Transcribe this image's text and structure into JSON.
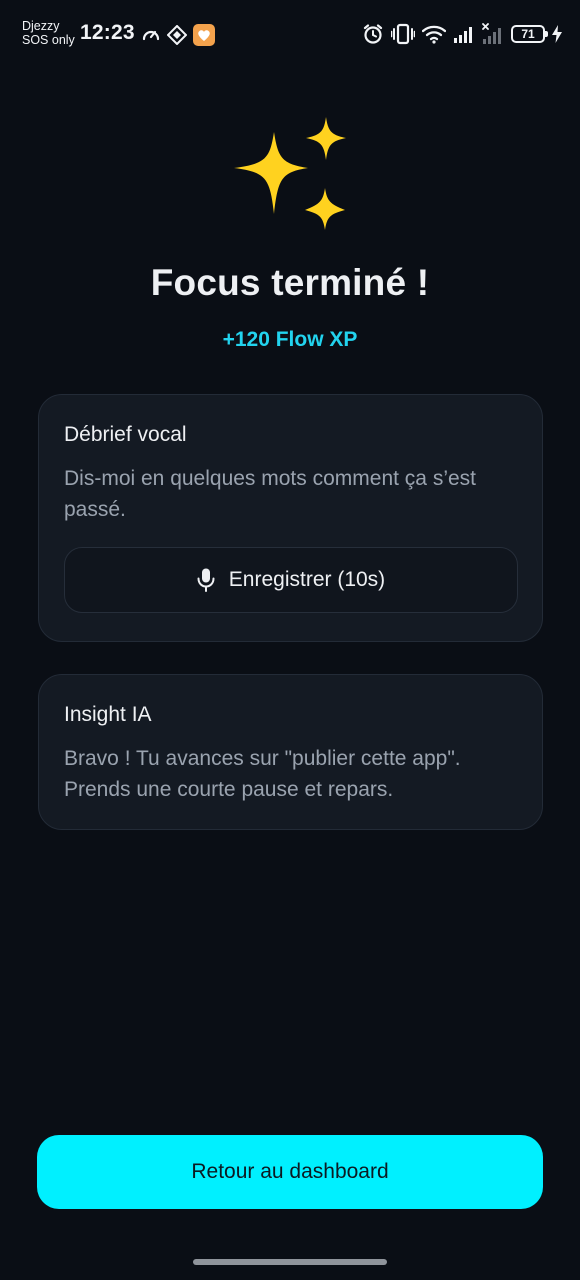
{
  "status_bar": {
    "carrier_line1": "Djezzy",
    "carrier_line2": "SOS only",
    "time": "12:23",
    "battery_level": "71",
    "icons_left": [
      "speedometer-icon",
      "app-diamond-icon",
      "app-heart-icon"
    ],
    "icons_right": [
      "alarm-icon",
      "vibrate-icon",
      "wifi-icon",
      "signal-icon",
      "signal-no-service-icon",
      "battery-icon",
      "charging-icon"
    ]
  },
  "hero": {
    "icon": "sparkles-icon",
    "title": "Focus terminé !",
    "xp_reward": "+120 Flow XP"
  },
  "debrief_card": {
    "title": "Débrief vocal",
    "description": "Dis-moi en quelques mots comment ça s’est passé.",
    "record_button_icon": "microphone-icon",
    "record_button_label": "Enregistrer (10s)"
  },
  "insight_card": {
    "title": "Insight IA",
    "message": "Bravo ! Tu avances sur \"publier cette app\". Prends une courte pause et repars."
  },
  "footer": {
    "dashboard_button_label": "Retour au dashboard"
  },
  "colors": {
    "background": "#0a0e15",
    "card": "#141a23",
    "accent": "#00f0ff",
    "xp_text": "#22d3ee",
    "sparkle": "#ffd21f"
  }
}
